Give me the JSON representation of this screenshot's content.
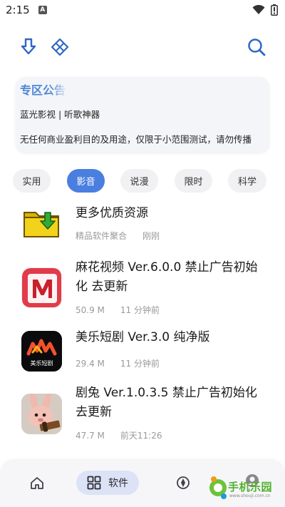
{
  "status_bar": {
    "time": "2:15",
    "notification_letter": "A",
    "icons": [
      "wifi-icon",
      "battery-icon"
    ]
  },
  "toolbar": {
    "left_icons": [
      "download-arrow-icon",
      "diamond-grid-icon"
    ],
    "right_icon": "search-icon",
    "accent_color": "#2f67c7"
  },
  "notice": {
    "title": "专区公告",
    "line1": "蓝光影视 | 听歌神器",
    "line2": "无任何商业盈利目的及用途，仅限于小范围测试，请勿传播"
  },
  "categories": {
    "items": [
      "实用",
      "影音",
      "说漫",
      "限时",
      "科学"
    ],
    "selected": "影音",
    "active_color": "#4a7fe0"
  },
  "apps": [
    {
      "title": "更多优质资源",
      "size": "精品软件聚合",
      "time": "刚刚",
      "icon": "folder-download-icon"
    },
    {
      "title": "麻花视频 Ver.6.0.0 禁止广告初始化 去更新",
      "size": "50.9 M",
      "time": "11 分钟前",
      "icon": "mahua-logo-icon"
    },
    {
      "title": "美乐短剧 Ver.3.0 纯净版",
      "size": "29.4 M",
      "time": "11 分钟前",
      "icon": "meile-logo-icon",
      "icon_caption": "美乐短剧"
    },
    {
      "title": "剧兔 Ver.1.0.3.5 禁止广告初始化去更新",
      "size": "47.7 M",
      "time": "前天11:26",
      "icon": "jutu-rabbit-icon"
    }
  ],
  "bottom_nav": {
    "items": [
      {
        "icon": "home-icon"
      },
      {
        "icon": "grid-apps-icon",
        "label": "软件",
        "active": true
      },
      {
        "icon": "compass-icon"
      },
      {
        "icon": "profile-icon"
      }
    ]
  },
  "watermark": {
    "text": "手机乐园",
    "url": "www.shouji.com.cn"
  }
}
